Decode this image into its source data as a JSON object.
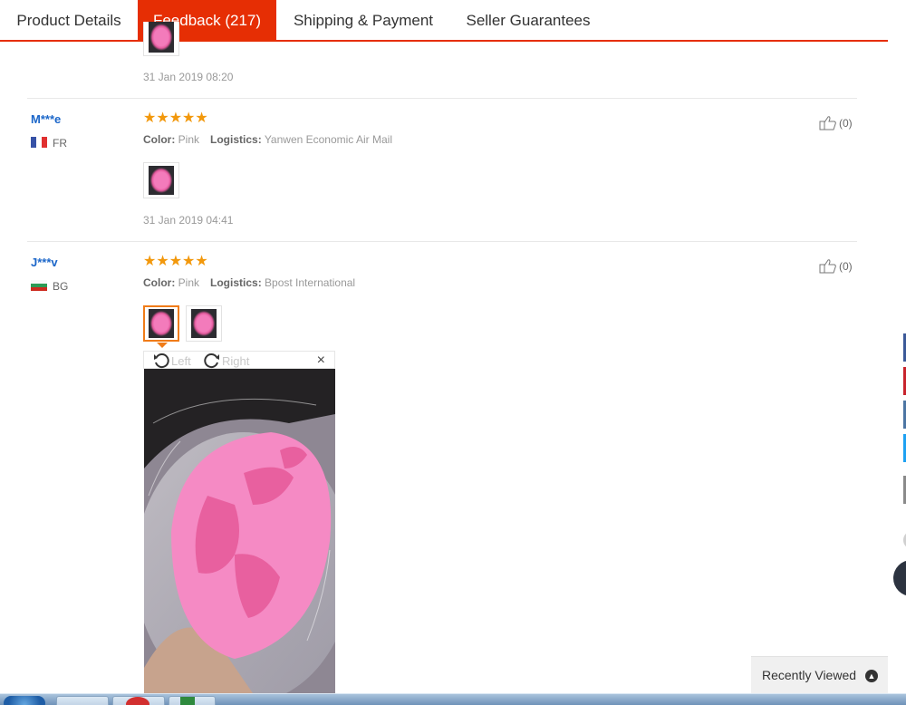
{
  "tabs": [
    {
      "label": "Product Details"
    },
    {
      "label": "Feedback (217)",
      "active": true
    },
    {
      "label": "Shipping & Payment"
    },
    {
      "label": "Seller Guarantees"
    }
  ],
  "labels": {
    "color": "Color:",
    "logistics": "Logistics:"
  },
  "prev_review": {
    "date": "31 Jan 2019 08:20"
  },
  "reviews": [
    {
      "user": "M***e",
      "country": "FR",
      "flag_icon": "flag-fr-icon",
      "rating": 5,
      "stars": "★★★★★",
      "color": "Pink",
      "logistics": "Yanwen Economic Air Mail",
      "date": "31 Jan 2019 04:41",
      "helpful": "(0)"
    },
    {
      "user": "J***v",
      "country": "BG",
      "flag_icon": "flag-bg-icon",
      "rating": 5,
      "stars": "★★★★★",
      "color": "Pink",
      "logistics": "Bpost International",
      "helpful": "(0)"
    }
  ],
  "viewer": {
    "left_label": "Left",
    "right_label": "Right",
    "close_label": "×"
  },
  "recently_viewed": {
    "label": "Recently Viewed",
    "icon": "chevron-up-icon"
  },
  "colors": {
    "accent": "#e62e04",
    "star": "#f2980c",
    "link": "#1b66c9",
    "share_facebook": "#3b5998",
    "share_pinterest": "#c8232c",
    "share_vk": "#4c75a3",
    "share_twitter": "#1da1f2"
  }
}
